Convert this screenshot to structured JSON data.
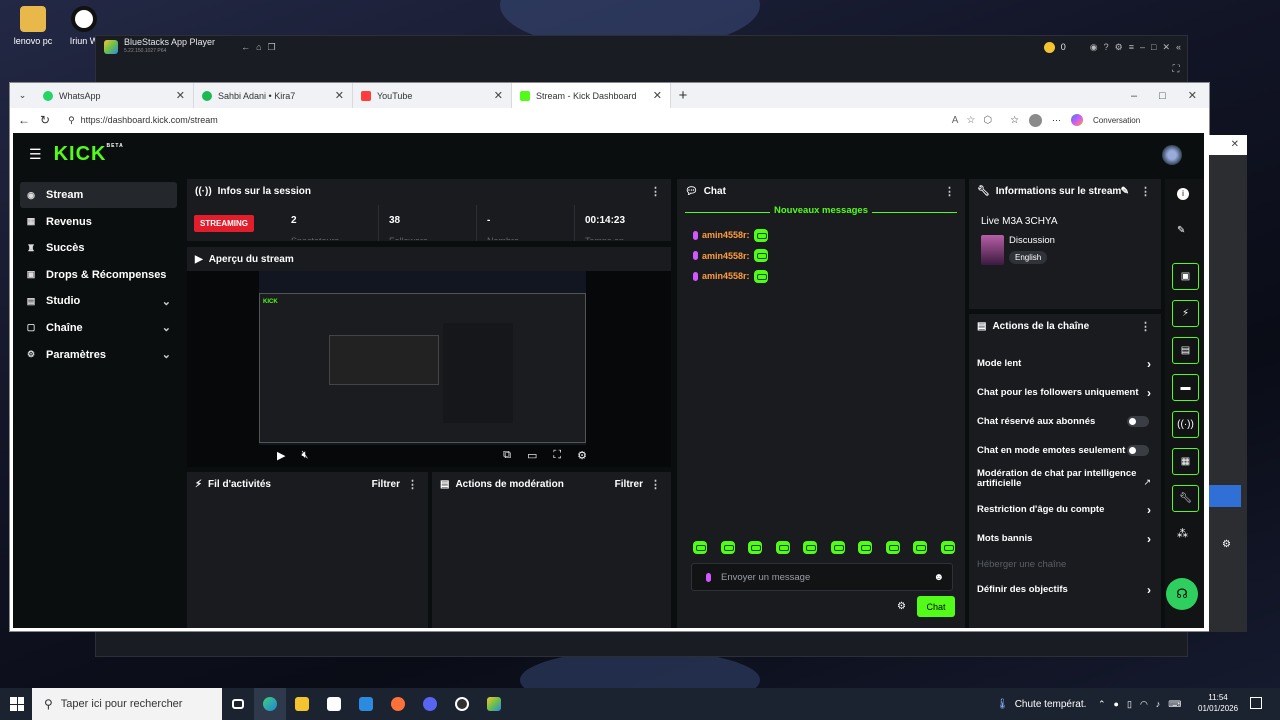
{
  "desktop": {
    "icons": [
      {
        "label": "lenovo pc"
      },
      {
        "label": "Iriun W"
      }
    ]
  },
  "bluestacks": {
    "title": "BlueStacks App Player",
    "subtitle": "5.22.150.1027  P64",
    "coins": "0"
  },
  "browser": {
    "tabs": [
      {
        "label": "WhatsApp",
        "color": "#25d366"
      },
      {
        "label": "Sahbi Adani • Kira7",
        "color": "#1db954"
      },
      {
        "label": "YouTube",
        "color": "#ff3b3b"
      },
      {
        "label": "Stream - Kick Dashboard",
        "color": "#53fc18"
      }
    ],
    "url": "https://dashboard.kick.com/stream",
    "conversation": "Conversation"
  },
  "kick": {
    "logo": "KICK",
    "logo_badge": "BETA",
    "nav": [
      {
        "label": "Stream",
        "icon": "stream-icon",
        "active": true
      },
      {
        "label": "Revenus",
        "icon": "revenue-icon"
      },
      {
        "label": "Succès",
        "icon": "trophy-icon"
      },
      {
        "label": "Drops & Récompenses",
        "icon": "gift-icon"
      },
      {
        "label": "Studio",
        "icon": "studio-icon",
        "chevron": true
      },
      {
        "label": "Chaîne",
        "icon": "channel-icon",
        "chevron": true
      },
      {
        "label": "Paramètres",
        "icon": "gear-icon",
        "chevron": true
      }
    ],
    "session": {
      "title": "Infos sur la session",
      "status": "STREAMING",
      "stats": [
        {
          "value": "2",
          "label": "Spectateurs"
        },
        {
          "value": "38",
          "label": "Followers"
        },
        {
          "value": "-",
          "label": "Nombre"
        },
        {
          "value": "00:14:23",
          "label": "Temps en"
        }
      ]
    },
    "preview": {
      "title": "Aperçu du stream"
    },
    "activity": {
      "title": "Fil d'activités",
      "filter": "Filtrer"
    },
    "moderation": {
      "title": "Actions de modération",
      "filter": "Filtrer"
    },
    "chat": {
      "title": "Chat",
      "new_messages": "Nouveaux messages",
      "messages": [
        {
          "user": "amin4558r:"
        },
        {
          "user": "amin4558r:"
        },
        {
          "user": "amin4558r:"
        }
      ],
      "placeholder": "Envoyer un message",
      "send": "Chat"
    },
    "stream_info": {
      "title": "Informations sur le stream",
      "stream_title": "Live M3A 3CHYA",
      "category": "Discussion",
      "language": "English"
    },
    "channel_actions": {
      "title": "Actions de la chaîne",
      "items": [
        {
          "label": "Mode lent",
          "type": "chevron"
        },
        {
          "label": "Chat pour les followers uniquement",
          "type": "chevron"
        },
        {
          "label": "Chat réservé aux abonnés",
          "type": "toggle"
        },
        {
          "label": "Chat en mode emotes seulement",
          "type": "toggle"
        },
        {
          "label": "Modération de chat par intelligence artificielle",
          "type": "external"
        },
        {
          "label": "Restriction d'âge du compte",
          "type": "chevron"
        },
        {
          "label": "Mots bannis",
          "type": "chevron"
        },
        {
          "label": "Héberger une chaîne",
          "type": "disabled"
        },
        {
          "label": "Définir des objectifs",
          "type": "chevron"
        }
      ]
    }
  },
  "taskbar": {
    "search_placeholder": "Taper ici pour rechercher",
    "weather": "Chute températ.",
    "time": "11:54",
    "date": "01/01/2026"
  }
}
